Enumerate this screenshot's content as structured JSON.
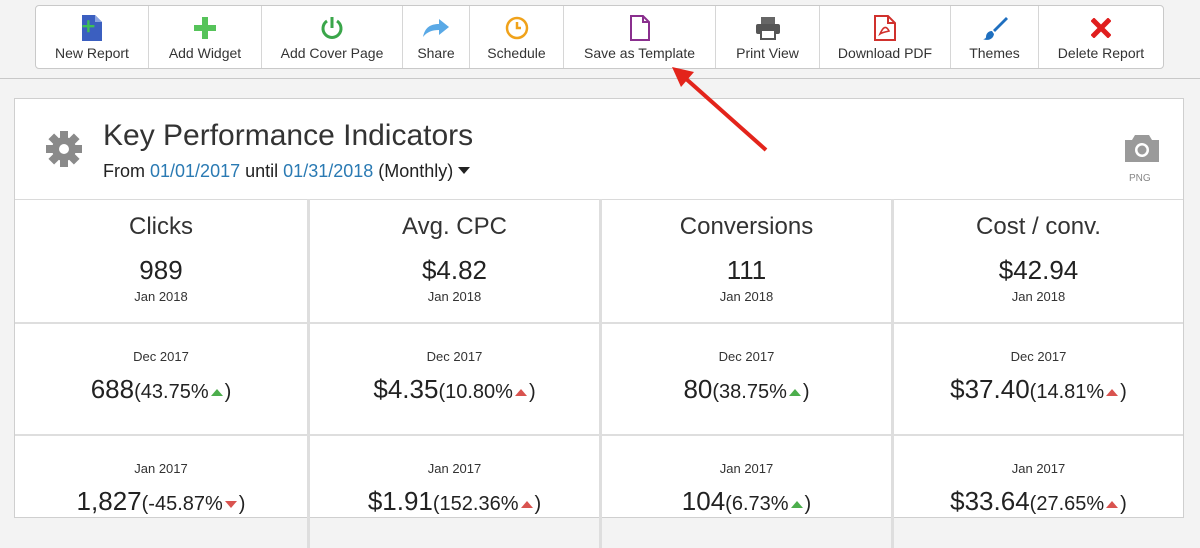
{
  "toolbar": {
    "buttons": [
      {
        "label": "New Report",
        "icon": "new-report-icon"
      },
      {
        "label": "Add Widget",
        "icon": "plus-icon"
      },
      {
        "label": "Add Cover Page",
        "icon": "power-icon"
      },
      {
        "label": "Share",
        "icon": "share-arrow-icon"
      },
      {
        "label": "Schedule",
        "icon": "clock-icon"
      },
      {
        "label": "Save as Template",
        "icon": "document-icon"
      },
      {
        "label": "Print View",
        "icon": "printer-icon"
      },
      {
        "label": "Download PDF",
        "icon": "pdf-icon"
      },
      {
        "label": "Themes",
        "icon": "brush-icon"
      },
      {
        "label": "Delete Report",
        "icon": "x-icon"
      }
    ]
  },
  "widget": {
    "title": "Key Performance Indicators",
    "range_prefix": "From",
    "range_start": "01/01/2017",
    "range_mid": "until",
    "range_end": "01/31/2018",
    "range_period": "(Monthly)",
    "png_label": "PNG"
  },
  "kpis": [
    {
      "name": "Clicks",
      "current": {
        "value": "989",
        "period": "Jan 2018"
      },
      "previous": {
        "period": "Dec 2017",
        "value": "688",
        "pct": "(43.75%",
        "close": ")",
        "trend": "up-green"
      },
      "year_ago": {
        "period": "Jan 2017",
        "value": "1,827",
        "pct": "(-45.87%",
        "close": ")",
        "trend": "down-red"
      }
    },
    {
      "name": "Avg. CPC",
      "current": {
        "value": "$4.82",
        "period": "Jan 2018"
      },
      "previous": {
        "period": "Dec 2017",
        "value": "$4.35",
        "pct": "(10.80%",
        "close": ")",
        "trend": "up-red"
      },
      "year_ago": {
        "period": "Jan 2017",
        "value": "$1.91",
        "pct": "(152.36%",
        "close": ")",
        "trend": "up-red"
      }
    },
    {
      "name": "Conversions",
      "current": {
        "value": "111",
        "period": "Jan 2018"
      },
      "previous": {
        "period": "Dec 2017",
        "value": "80",
        "pct": "(38.75%",
        "close": ")",
        "trend": "up-green"
      },
      "year_ago": {
        "period": "Jan 2017",
        "value": "104",
        "pct": "(6.73%",
        "close": ")",
        "trend": "up-green"
      }
    },
    {
      "name": "Cost / conv.",
      "current": {
        "value": "$42.94",
        "period": "Jan 2018"
      },
      "previous": {
        "period": "Dec 2017",
        "value": "$37.40",
        "pct": "(14.81%",
        "close": ")",
        "trend": "up-red"
      },
      "year_ago": {
        "period": "Jan 2017",
        "value": "$33.64",
        "pct": "(27.65%",
        "close": ")",
        "trend": "up-red"
      }
    }
  ],
  "colors": {
    "link": "#2a7ab3",
    "trend_up": "#4cae4c",
    "trend_bad": "#d9534f",
    "annotation_arrow": "#e3241b"
  }
}
